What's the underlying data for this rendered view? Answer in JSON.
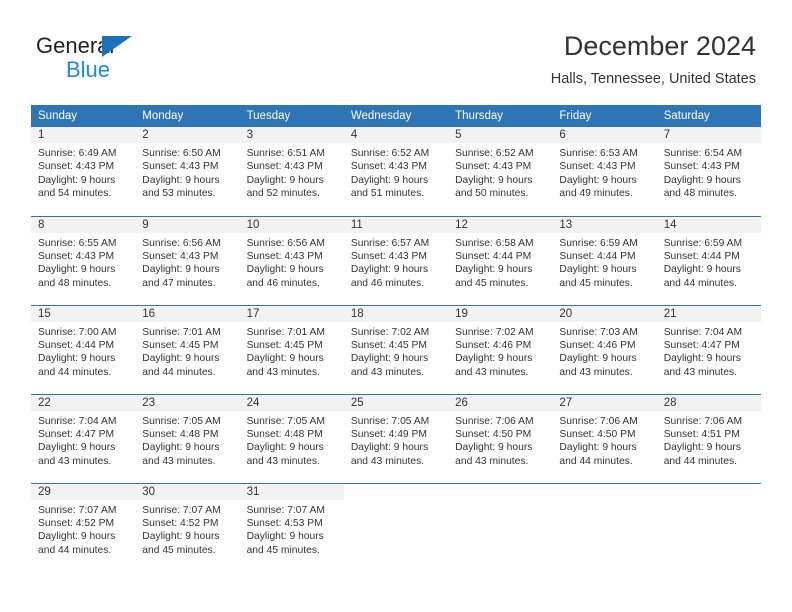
{
  "brand": {
    "name_part1": "General",
    "name_part2": "Blue",
    "triangle_color": "#1b72b8",
    "blue_text_color": "#1b8ade"
  },
  "header": {
    "title": "December 2024",
    "location": "Halls, Tennessee, United States"
  },
  "theme": {
    "header_blue": "#2e75b6",
    "daynum_band": "#f2f2f2",
    "text": "#333333"
  },
  "calendar": {
    "weekday_headers": [
      "Sunday",
      "Monday",
      "Tuesday",
      "Wednesday",
      "Thursday",
      "Friday",
      "Saturday"
    ],
    "weeks": [
      [
        {
          "day": "1",
          "sunrise": "Sunrise: 6:49 AM",
          "sunset": "Sunset: 4:43 PM",
          "daylight_line1": "Daylight: 9 hours",
          "daylight_line2": "and 54 minutes."
        },
        {
          "day": "2",
          "sunrise": "Sunrise: 6:50 AM",
          "sunset": "Sunset: 4:43 PM",
          "daylight_line1": "Daylight: 9 hours",
          "daylight_line2": "and 53 minutes."
        },
        {
          "day": "3",
          "sunrise": "Sunrise: 6:51 AM",
          "sunset": "Sunset: 4:43 PM",
          "daylight_line1": "Daylight: 9 hours",
          "daylight_line2": "and 52 minutes."
        },
        {
          "day": "4",
          "sunrise": "Sunrise: 6:52 AM",
          "sunset": "Sunset: 4:43 PM",
          "daylight_line1": "Daylight: 9 hours",
          "daylight_line2": "and 51 minutes."
        },
        {
          "day": "5",
          "sunrise": "Sunrise: 6:52 AM",
          "sunset": "Sunset: 4:43 PM",
          "daylight_line1": "Daylight: 9 hours",
          "daylight_line2": "and 50 minutes."
        },
        {
          "day": "6",
          "sunrise": "Sunrise: 6:53 AM",
          "sunset": "Sunset: 4:43 PM",
          "daylight_line1": "Daylight: 9 hours",
          "daylight_line2": "and 49 minutes."
        },
        {
          "day": "7",
          "sunrise": "Sunrise: 6:54 AM",
          "sunset": "Sunset: 4:43 PM",
          "daylight_line1": "Daylight: 9 hours",
          "daylight_line2": "and 48 minutes."
        }
      ],
      [
        {
          "day": "8",
          "sunrise": "Sunrise: 6:55 AM",
          "sunset": "Sunset: 4:43 PM",
          "daylight_line1": "Daylight: 9 hours",
          "daylight_line2": "and 48 minutes."
        },
        {
          "day": "9",
          "sunrise": "Sunrise: 6:56 AM",
          "sunset": "Sunset: 4:43 PM",
          "daylight_line1": "Daylight: 9 hours",
          "daylight_line2": "and 47 minutes."
        },
        {
          "day": "10",
          "sunrise": "Sunrise: 6:56 AM",
          "sunset": "Sunset: 4:43 PM",
          "daylight_line1": "Daylight: 9 hours",
          "daylight_line2": "and 46 minutes."
        },
        {
          "day": "11",
          "sunrise": "Sunrise: 6:57 AM",
          "sunset": "Sunset: 4:43 PM",
          "daylight_line1": "Daylight: 9 hours",
          "daylight_line2": "and 46 minutes."
        },
        {
          "day": "12",
          "sunrise": "Sunrise: 6:58 AM",
          "sunset": "Sunset: 4:44 PM",
          "daylight_line1": "Daylight: 9 hours",
          "daylight_line2": "and 45 minutes."
        },
        {
          "day": "13",
          "sunrise": "Sunrise: 6:59 AM",
          "sunset": "Sunset: 4:44 PM",
          "daylight_line1": "Daylight: 9 hours",
          "daylight_line2": "and 45 minutes."
        },
        {
          "day": "14",
          "sunrise": "Sunrise: 6:59 AM",
          "sunset": "Sunset: 4:44 PM",
          "daylight_line1": "Daylight: 9 hours",
          "daylight_line2": "and 44 minutes."
        }
      ],
      [
        {
          "day": "15",
          "sunrise": "Sunrise: 7:00 AM",
          "sunset": "Sunset: 4:44 PM",
          "daylight_line1": "Daylight: 9 hours",
          "daylight_line2": "and 44 minutes."
        },
        {
          "day": "16",
          "sunrise": "Sunrise: 7:01 AM",
          "sunset": "Sunset: 4:45 PM",
          "daylight_line1": "Daylight: 9 hours",
          "daylight_line2": "and 44 minutes."
        },
        {
          "day": "17",
          "sunrise": "Sunrise: 7:01 AM",
          "sunset": "Sunset: 4:45 PM",
          "daylight_line1": "Daylight: 9 hours",
          "daylight_line2": "and 43 minutes."
        },
        {
          "day": "18",
          "sunrise": "Sunrise: 7:02 AM",
          "sunset": "Sunset: 4:45 PM",
          "daylight_line1": "Daylight: 9 hours",
          "daylight_line2": "and 43 minutes."
        },
        {
          "day": "19",
          "sunrise": "Sunrise: 7:02 AM",
          "sunset": "Sunset: 4:46 PM",
          "daylight_line1": "Daylight: 9 hours",
          "daylight_line2": "and 43 minutes."
        },
        {
          "day": "20",
          "sunrise": "Sunrise: 7:03 AM",
          "sunset": "Sunset: 4:46 PM",
          "daylight_line1": "Daylight: 9 hours",
          "daylight_line2": "and 43 minutes."
        },
        {
          "day": "21",
          "sunrise": "Sunrise: 7:04 AM",
          "sunset": "Sunset: 4:47 PM",
          "daylight_line1": "Daylight: 9 hours",
          "daylight_line2": "and 43 minutes."
        }
      ],
      [
        {
          "day": "22",
          "sunrise": "Sunrise: 7:04 AM",
          "sunset": "Sunset: 4:47 PM",
          "daylight_line1": "Daylight: 9 hours",
          "daylight_line2": "and 43 minutes."
        },
        {
          "day": "23",
          "sunrise": "Sunrise: 7:05 AM",
          "sunset": "Sunset: 4:48 PM",
          "daylight_line1": "Daylight: 9 hours",
          "daylight_line2": "and 43 minutes."
        },
        {
          "day": "24",
          "sunrise": "Sunrise: 7:05 AM",
          "sunset": "Sunset: 4:48 PM",
          "daylight_line1": "Daylight: 9 hours",
          "daylight_line2": "and 43 minutes."
        },
        {
          "day": "25",
          "sunrise": "Sunrise: 7:05 AM",
          "sunset": "Sunset: 4:49 PM",
          "daylight_line1": "Daylight: 9 hours",
          "daylight_line2": "and 43 minutes."
        },
        {
          "day": "26",
          "sunrise": "Sunrise: 7:06 AM",
          "sunset": "Sunset: 4:50 PM",
          "daylight_line1": "Daylight: 9 hours",
          "daylight_line2": "and 43 minutes."
        },
        {
          "day": "27",
          "sunrise": "Sunrise: 7:06 AM",
          "sunset": "Sunset: 4:50 PM",
          "daylight_line1": "Daylight: 9 hours",
          "daylight_line2": "and 44 minutes."
        },
        {
          "day": "28",
          "sunrise": "Sunrise: 7:06 AM",
          "sunset": "Sunset: 4:51 PM",
          "daylight_line1": "Daylight: 9 hours",
          "daylight_line2": "and 44 minutes."
        }
      ],
      [
        {
          "day": "29",
          "sunrise": "Sunrise: 7:07 AM",
          "sunset": "Sunset: 4:52 PM",
          "daylight_line1": "Daylight: 9 hours",
          "daylight_line2": "and 44 minutes."
        },
        {
          "day": "30",
          "sunrise": "Sunrise: 7:07 AM",
          "sunset": "Sunset: 4:52 PM",
          "daylight_line1": "Daylight: 9 hours",
          "daylight_line2": "and 45 minutes."
        },
        {
          "day": "31",
          "sunrise": "Sunrise: 7:07 AM",
          "sunset": "Sunset: 4:53 PM",
          "daylight_line1": "Daylight: 9 hours",
          "daylight_line2": "and 45 minutes."
        },
        {
          "day": "",
          "sunrise": "",
          "sunset": "",
          "daylight_line1": "",
          "daylight_line2": ""
        },
        {
          "day": "",
          "sunrise": "",
          "sunset": "",
          "daylight_line1": "",
          "daylight_line2": ""
        },
        {
          "day": "",
          "sunrise": "",
          "sunset": "",
          "daylight_line1": "",
          "daylight_line2": ""
        },
        {
          "day": "",
          "sunrise": "",
          "sunset": "",
          "daylight_line1": "",
          "daylight_line2": ""
        }
      ]
    ]
  }
}
